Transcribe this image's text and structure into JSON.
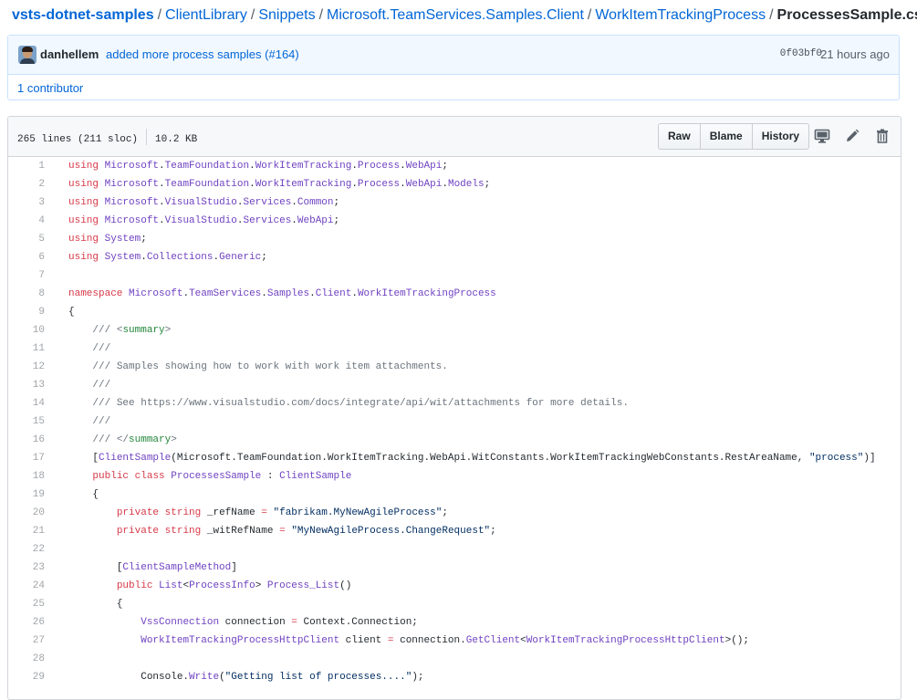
{
  "breadcrumb": {
    "repo": "vsts-dotnet-samples",
    "parts": [
      "ClientLibrary",
      "Snippets",
      "Microsoft.TeamServices.Samples.Client",
      "WorkItemTrackingProcess"
    ],
    "file": "ProcessesSample.cs",
    "separator": "/"
  },
  "commit": {
    "author": "danhellem",
    "message": "added more process samples (",
    "pr": "#164",
    "message_end": ")",
    "sha": "0f03bf0",
    "time": "21 hours ago",
    "contributors": "1 contributor"
  },
  "file": {
    "lines_info": "265 lines (211 sloc)",
    "size": "10.2 KB",
    "buttons": {
      "raw": "Raw",
      "blame": "Blame",
      "history": "History"
    }
  },
  "code": [
    {
      "n": "1",
      "t": [
        [
          "k",
          "using"
        ],
        [
          "",
          " "
        ],
        [
          "e",
          "Microsoft"
        ],
        [
          "",
          "."
        ],
        [
          "e",
          "TeamFoundation"
        ],
        [
          "",
          "."
        ],
        [
          "e",
          "WorkItemTracking"
        ],
        [
          "",
          "."
        ],
        [
          "e",
          "Process"
        ],
        [
          "",
          "."
        ],
        [
          "e",
          "WebApi"
        ],
        [
          "",
          ";"
        ]
      ]
    },
    {
      "n": "2",
      "t": [
        [
          "k",
          "using"
        ],
        [
          "",
          " "
        ],
        [
          "e",
          "Microsoft"
        ],
        [
          "",
          "."
        ],
        [
          "e",
          "TeamFoundation"
        ],
        [
          "",
          "."
        ],
        [
          "e",
          "WorkItemTracking"
        ],
        [
          "",
          "."
        ],
        [
          "e",
          "Process"
        ],
        [
          "",
          "."
        ],
        [
          "e",
          "WebApi"
        ],
        [
          "",
          "."
        ],
        [
          "e",
          "Models"
        ],
        [
          "",
          ";"
        ]
      ]
    },
    {
      "n": "3",
      "t": [
        [
          "k",
          "using"
        ],
        [
          "",
          " "
        ],
        [
          "e",
          "Microsoft"
        ],
        [
          "",
          "."
        ],
        [
          "e",
          "VisualStudio"
        ],
        [
          "",
          "."
        ],
        [
          "e",
          "Services"
        ],
        [
          "",
          "."
        ],
        [
          "e",
          "Common"
        ],
        [
          "",
          ";"
        ]
      ]
    },
    {
      "n": "4",
      "t": [
        [
          "k",
          "using"
        ],
        [
          "",
          " "
        ],
        [
          "e",
          "Microsoft"
        ],
        [
          "",
          "."
        ],
        [
          "e",
          "VisualStudio"
        ],
        [
          "",
          "."
        ],
        [
          "e",
          "Services"
        ],
        [
          "",
          "."
        ],
        [
          "e",
          "WebApi"
        ],
        [
          "",
          ";"
        ]
      ]
    },
    {
      "n": "5",
      "t": [
        [
          "k",
          "using"
        ],
        [
          "",
          " "
        ],
        [
          "e",
          "System"
        ],
        [
          "",
          ";"
        ]
      ]
    },
    {
      "n": "6",
      "t": [
        [
          "k",
          "using"
        ],
        [
          "",
          " "
        ],
        [
          "e",
          "System"
        ],
        [
          "",
          "."
        ],
        [
          "e",
          "Collections"
        ],
        [
          "",
          "."
        ],
        [
          "e",
          "Generic"
        ],
        [
          "",
          ";"
        ]
      ]
    },
    {
      "n": "7",
      "t": []
    },
    {
      "n": "8",
      "t": [
        [
          "k",
          "namespace"
        ],
        [
          "",
          " "
        ],
        [
          "e",
          "Microsoft"
        ],
        [
          "",
          "."
        ],
        [
          "e",
          "TeamServices"
        ],
        [
          "",
          "."
        ],
        [
          "e",
          "Samples"
        ],
        [
          "",
          "."
        ],
        [
          "e",
          "Client"
        ],
        [
          "",
          "."
        ],
        [
          "e",
          "WorkItemTrackingProcess"
        ]
      ]
    },
    {
      "n": "9",
      "t": [
        [
          "",
          "{"
        ]
      ]
    },
    {
      "n": "10",
      "t": [
        [
          "",
          " "
        ],
        [
          "c",
          "/// "
        ],
        [
          "c",
          "<"
        ],
        [
          "g",
          "summary"
        ],
        [
          "c",
          ">"
        ]
      ]
    },
    {
      "n": "11",
      "t": [
        [
          "",
          " "
        ],
        [
          "c",
          "///"
        ]
      ]
    },
    {
      "n": "12",
      "t": [
        [
          "",
          " "
        ],
        [
          "c",
          "/// Samples showing how to work with work item attachments."
        ]
      ]
    },
    {
      "n": "13",
      "t": [
        [
          "",
          " "
        ],
        [
          "c",
          "///"
        ]
      ]
    },
    {
      "n": "14",
      "t": [
        [
          "",
          " "
        ],
        [
          "c",
          "/// See https://www.visualstudio.com/docs/integrate/api/wit/attachments for more details."
        ]
      ]
    },
    {
      "n": "15",
      "t": [
        [
          "",
          " "
        ],
        [
          "c",
          "///"
        ]
      ]
    },
    {
      "n": "16",
      "t": [
        [
          "",
          " "
        ],
        [
          "c",
          "/// </"
        ],
        [
          "g",
          "summary"
        ],
        [
          "c",
          ">"
        ]
      ]
    },
    {
      "n": "17",
      "t": [
        [
          "",
          " ["
        ],
        [
          "e",
          "ClientSample"
        ],
        [
          "",
          "(Microsoft.TeamFoundation.WorkItemTracking.WebApi.WitConstants.WorkItemTrackingWebConstants.RestAreaName, "
        ],
        [
          "s",
          "\"process\""
        ],
        [
          "",
          ")]"
        ]
      ]
    },
    {
      "n": "18",
      "t": [
        [
          "",
          " "
        ],
        [
          "k",
          "public"
        ],
        [
          "",
          " "
        ],
        [
          "k",
          "class"
        ],
        [
          "",
          " "
        ],
        [
          "e",
          "ProcessesSample"
        ],
        [
          "",
          " : "
        ],
        [
          "e",
          "ClientSample"
        ]
      ]
    },
    {
      "n": "19",
      "t": [
        [
          "",
          " {"
        ]
      ]
    },
    {
      "n": "20",
      "t": [
        [
          "",
          " "
        ],
        [
          "k",
          "private"
        ],
        [
          "",
          " "
        ],
        [
          "k",
          "string"
        ],
        [
          "",
          " _refName "
        ],
        [
          "k",
          "="
        ],
        [
          "",
          " "
        ],
        [
          "s",
          "\"fabrikam.MyNewAgileProcess\""
        ],
        [
          "",
          ";"
        ]
      ]
    },
    {
      "n": "21",
      "t": [
        [
          "",
          " "
        ],
        [
          "k",
          "private"
        ],
        [
          "",
          " "
        ],
        [
          "k",
          "string"
        ],
        [
          "",
          " _witRefName "
        ],
        [
          "k",
          "="
        ],
        [
          "",
          " "
        ],
        [
          "s",
          "\"MyNewAgileProcess.ChangeRequest\""
        ],
        [
          "",
          ";"
        ]
      ]
    },
    {
      "n": "22",
      "t": []
    },
    {
      "n": "23",
      "t": [
        [
          "",
          " ["
        ],
        [
          "e",
          "ClientSampleMethod"
        ],
        [
          "",
          "]"
        ]
      ]
    },
    {
      "n": "24",
      "t": [
        [
          "",
          " "
        ],
        [
          "k",
          "public"
        ],
        [
          "",
          " "
        ],
        [
          "e",
          "List"
        ],
        [
          "",
          "<"
        ],
        [
          "e",
          "ProcessInfo"
        ],
        [
          "",
          "> "
        ],
        [
          "e",
          "Process_List"
        ],
        [
          "",
          "()"
        ]
      ]
    },
    {
      "n": "25",
      "t": [
        [
          "",
          " {"
        ]
      ]
    },
    {
      "n": "26",
      "t": [
        [
          "",
          " "
        ],
        [
          "e",
          "VssConnection"
        ],
        [
          "",
          " connection "
        ],
        [
          "k",
          "="
        ],
        [
          "",
          " Context.Connection;"
        ]
      ]
    },
    {
      "n": "27",
      "t": [
        [
          "",
          " "
        ],
        [
          "e",
          "WorkItemTrackingProcessHttpClient"
        ],
        [
          "",
          " client "
        ],
        [
          "k",
          "="
        ],
        [
          "",
          " connection."
        ],
        [
          "e",
          "GetClient"
        ],
        [
          "",
          "<"
        ],
        [
          "e",
          "WorkItemTrackingProcessHttpClient"
        ],
        [
          "",
          ">();"
        ]
      ]
    },
    {
      "n": "28",
      "t": []
    },
    {
      "n": "29",
      "t": [
        [
          "",
          " Console."
        ],
        [
          "e",
          "Write"
        ],
        [
          "",
          "("
        ],
        [
          "s",
          "\"Getting list of processes....\""
        ],
        [
          "",
          ");"
        ]
      ]
    }
  ],
  "icons": {
    "display": "desktop-icon",
    "edit": "pencil-icon",
    "delete": "trash-icon"
  },
  "colors": {
    "link": "#0366d6",
    "keyword": "#d73a49",
    "entity": "#6f42c1",
    "comment": "#6a737d",
    "tag": "#22863a",
    "string": "#032f62"
  }
}
